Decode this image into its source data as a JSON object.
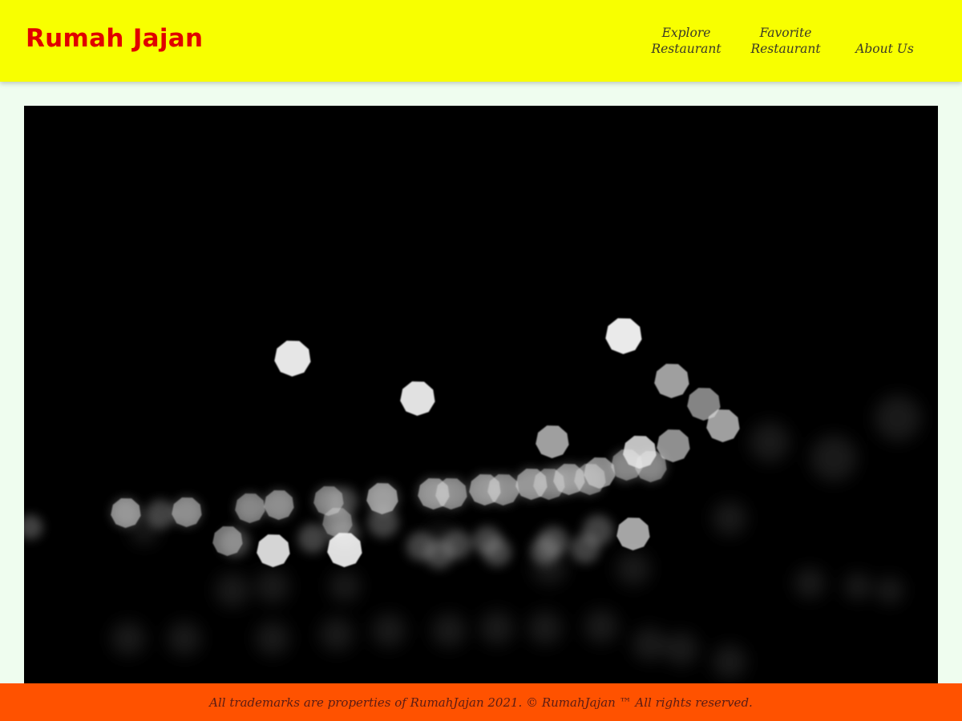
{
  "header": {
    "brand": "Rumah Jajan",
    "nav": [
      {
        "line1": "Explore",
        "line2": "Restaurant"
      },
      {
        "line1": "Favorite",
        "line2": "Restaurant"
      },
      {
        "line1": "",
        "line2": "About Us"
      }
    ]
  },
  "hero": {
    "image_name": "bokeh-night-lights-image"
  },
  "footer": {
    "text": "All trademarks are properties of RumahJajan 2021. © RumahJajan ™ All rights reserved."
  },
  "colors": {
    "header_bg": "#f8ff00",
    "brand": "#e00000",
    "page_bg": "#effdef",
    "footer_bg": "#ff5200",
    "footer_text": "#5a1c14"
  }
}
